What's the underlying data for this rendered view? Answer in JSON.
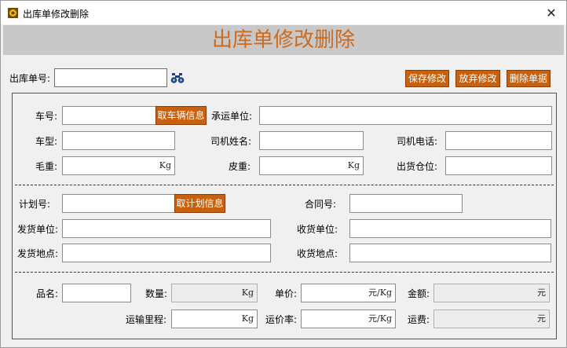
{
  "window": {
    "title": "出库单修改删除",
    "banner": "出库单修改删除"
  },
  "header": {
    "order_no_label": "出库单号:",
    "order_no_value": "",
    "save_label": "保存修改",
    "discard_label": "放弃修改",
    "delete_label": "删除单据"
  },
  "vehicle": {
    "plate_label": "车号:",
    "plate_value": "",
    "fetch_vehicle_label": "取车辆信息",
    "carrier_label": "承运单位:",
    "carrier_value": "",
    "model_label": "车型:",
    "model_value": "",
    "driver_name_label": "司机姓名:",
    "driver_name_value": "",
    "driver_phone_label": "司机电话:",
    "driver_phone_value": "",
    "gross_label": "毛重:",
    "gross_value": "",
    "gross_unit": "Kg",
    "tare_label": "皮重:",
    "tare_value": "",
    "tare_unit": "Kg",
    "warehouse_label": "出货仓位:",
    "warehouse_value": ""
  },
  "plan": {
    "plan_no_label": "计划号:",
    "plan_no_value": "",
    "fetch_plan_label": "取计划信息",
    "contract_label": "合同号:",
    "contract_value": "",
    "sender_label": "发货单位:",
    "sender_value": "",
    "receiver_label": "收货单位:",
    "receiver_value": "",
    "send_place_label": "发货地点:",
    "send_place_value": "",
    "receive_place_label": "收货地点:",
    "receive_place_value": ""
  },
  "goods": {
    "product_label": "品名:",
    "product_value": "",
    "quantity_label": "数量:",
    "quantity_value": "",
    "quantity_unit": "Kg",
    "price_label": "单价:",
    "price_value": "",
    "price_unit": "元/Kg",
    "amount_label": "金额:",
    "amount_value": "",
    "amount_unit": "元",
    "distance_label": "运输里程:",
    "distance_value": "",
    "distance_unit": "Kg",
    "freight_rate_label": "运价率:",
    "freight_rate_value": "",
    "freight_rate_unit": "元/Kg",
    "freight_label": "运费:",
    "freight_value": "",
    "freight_unit": "元"
  },
  "icons": {
    "app": "app-icon",
    "search": "binoculars-icon",
    "close": "close-icon"
  }
}
